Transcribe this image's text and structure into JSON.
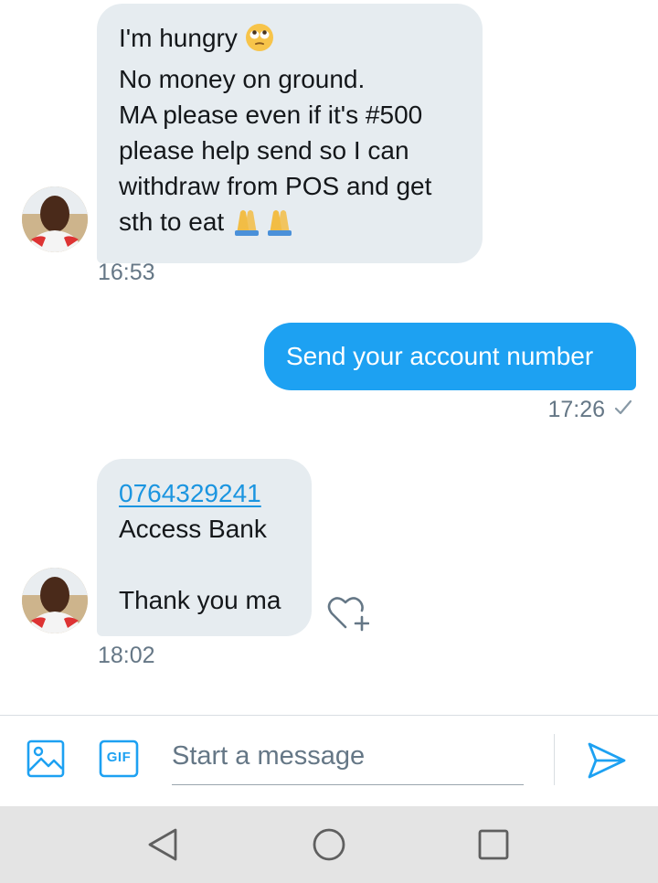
{
  "messages": [
    {
      "direction": "incoming",
      "lines": [
        "I'm hungry",
        "No money on ground.",
        "MA please even if it's #500",
        "please help send so I can",
        "withdraw from POS and get",
        "sth to eat"
      ],
      "time": "16:53"
    },
    {
      "direction": "outgoing",
      "text": "Send your account number",
      "time": "17:26",
      "status_icon": "read-check-icon"
    },
    {
      "direction": "incoming",
      "link": "0764329241",
      "lines": [
        "Access Bank",
        "",
        "Thank you ma"
      ],
      "time": "18:02",
      "reaction_icon": "heart-plus-icon"
    }
  ],
  "composer": {
    "placeholder": "Start a message",
    "gif_label": "GIF",
    "icons": [
      "image-icon",
      "gif-icon",
      "send-icon"
    ]
  },
  "navigation": {
    "icons": [
      "back-icon",
      "home-icon",
      "recents-icon"
    ]
  },
  "colors": {
    "accent": "#1da1f2",
    "incoming_bubble": "#e6ecf0",
    "timestamp": "#657786",
    "nav_bar": "#e4e4e4"
  }
}
